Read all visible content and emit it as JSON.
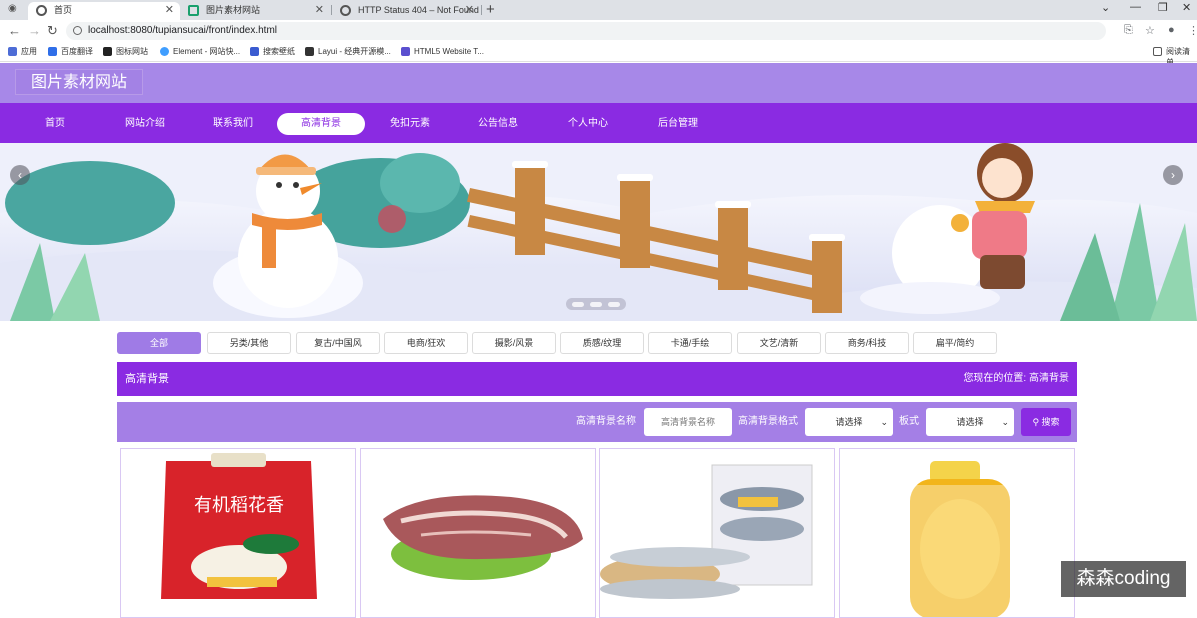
{
  "browser": {
    "tabs": [
      {
        "label": "首页"
      },
      {
        "label": "图片素材网站"
      },
      {
        "label": "HTTP Status 404 – Not Found"
      }
    ],
    "url": "localhost:8080/tupiansucai/front/index.html",
    "bookmarks": [
      "应用",
      "百度翻译",
      "图标网站",
      "Element - 网站快...",
      "搜索壁纸",
      "Layui - 经典开源模...",
      "HTML5 Website T..."
    ],
    "reading_list": "阅读清单"
  },
  "site": {
    "logo": "图片素材网站",
    "nav": [
      "首页",
      "网站介绍",
      "联系我们",
      "高清背景",
      "免扣元素",
      "公告信息",
      "个人中心",
      "后台管理"
    ],
    "nav_active_index": 3,
    "accent_color": "#8a2be2"
  },
  "categories": [
    "全部",
    "另类/其他",
    "复古/中国风",
    "电商/狂欢",
    "摄影/风景",
    "质感/纹理",
    "卡通/手绘",
    "文艺/清新",
    "商务/科技",
    "扁平/简约"
  ],
  "section": {
    "title": "高清背景",
    "location_prefix": "您现在的位置:",
    "location": "高清背景"
  },
  "search": {
    "name_label": "高清背景名称",
    "name_placeholder": "高清背景名称",
    "format_label": "高清背景格式",
    "format_value": "请选择",
    "style_label": "板式",
    "style_value": "请选择",
    "button": "搜索"
  },
  "cards": [
    {
      "image": "rice-bag",
      "text": "有机稻花香"
    },
    {
      "image": "raw-meat"
    },
    {
      "image": "yellow-croaker-fish"
    },
    {
      "image": "cooking-oil-bottle"
    }
  ],
  "watermark": "森森coding"
}
